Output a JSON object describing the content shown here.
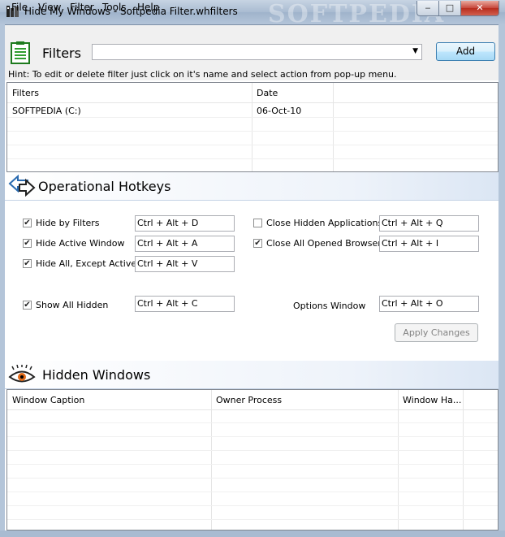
{
  "window": {
    "title": "Hide My Windows - Softpedia Filter.whfilters",
    "minimize": "‒",
    "maximize": "□",
    "close": "✕",
    "watermark": "SOFTPEDIA"
  },
  "menu": [
    "File",
    "View",
    "Filter",
    "Tools",
    "Help"
  ],
  "filters": {
    "label": "Filters",
    "combo_value": "",
    "combo_arrow": "▼",
    "add_label": "Add",
    "hint": "Hint: To edit or delete filter just click on it's name and select action from pop-up menu.",
    "columns": [
      "Filters",
      "Date"
    ],
    "rows": [
      {
        "name": "SOFTPEDIA (C:)",
        "date": "06-Oct-10"
      }
    ]
  },
  "hotkeys": {
    "title": "Operational Hotkeys",
    "left": [
      {
        "label": "Hide by Filters",
        "checked": true,
        "key": "Ctrl + Alt + D"
      },
      {
        "label": "Hide Active Window",
        "checked": true,
        "key": "Ctrl + Alt + A"
      },
      {
        "label": "Hide All, Except Active",
        "checked": true,
        "key": "Ctrl + Alt + V"
      },
      {
        "label": "Show All Hidden",
        "checked": true,
        "key": "Ctrl + Alt + C"
      }
    ],
    "right": [
      {
        "label": "Close Hidden Applications",
        "checked": false,
        "key": "Ctrl + Alt + Q"
      },
      {
        "label": "Close All Opened Browsers",
        "checked": true,
        "key": "Ctrl + Alt + I"
      }
    ],
    "options_label": "Options Window",
    "options_key": "Ctrl + Alt + O",
    "apply_label": "Apply Changes",
    "check_mark": "✔"
  },
  "hidden": {
    "title": "Hidden Windows",
    "columns": [
      "Window Caption",
      "Owner Process",
      "Window Ha..."
    ]
  },
  "colors": {
    "accent": "#3c7fb1",
    "section_gradient_end": "#dbe6f4"
  }
}
